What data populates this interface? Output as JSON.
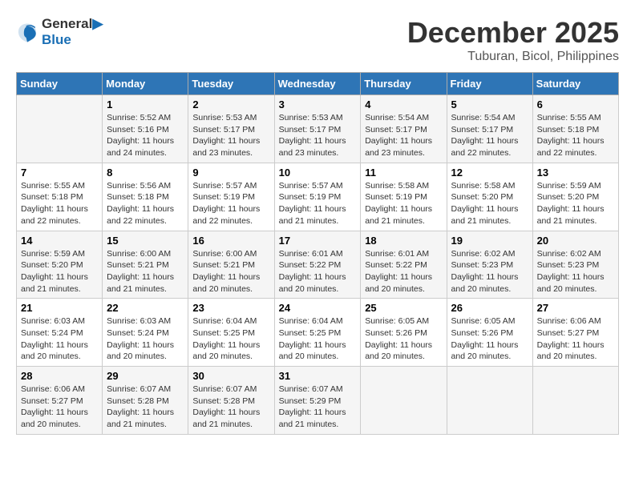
{
  "logo": {
    "line1": "General",
    "line2": "Blue"
  },
  "header": {
    "month": "December 2025",
    "location": "Tuburan, Bicol, Philippines"
  },
  "weekdays": [
    "Sunday",
    "Monday",
    "Tuesday",
    "Wednesday",
    "Thursday",
    "Friday",
    "Saturday"
  ],
  "weeks": [
    [
      {
        "day": "",
        "sunrise": "",
        "sunset": "",
        "daylight": ""
      },
      {
        "day": "1",
        "sunrise": "Sunrise: 5:52 AM",
        "sunset": "Sunset: 5:16 PM",
        "daylight": "Daylight: 11 hours and 24 minutes."
      },
      {
        "day": "2",
        "sunrise": "Sunrise: 5:53 AM",
        "sunset": "Sunset: 5:17 PM",
        "daylight": "Daylight: 11 hours and 23 minutes."
      },
      {
        "day": "3",
        "sunrise": "Sunrise: 5:53 AM",
        "sunset": "Sunset: 5:17 PM",
        "daylight": "Daylight: 11 hours and 23 minutes."
      },
      {
        "day": "4",
        "sunrise": "Sunrise: 5:54 AM",
        "sunset": "Sunset: 5:17 PM",
        "daylight": "Daylight: 11 hours and 23 minutes."
      },
      {
        "day": "5",
        "sunrise": "Sunrise: 5:54 AM",
        "sunset": "Sunset: 5:17 PM",
        "daylight": "Daylight: 11 hours and 22 minutes."
      },
      {
        "day": "6",
        "sunrise": "Sunrise: 5:55 AM",
        "sunset": "Sunset: 5:18 PM",
        "daylight": "Daylight: 11 hours and 22 minutes."
      }
    ],
    [
      {
        "day": "7",
        "sunrise": "Sunrise: 5:55 AM",
        "sunset": "Sunset: 5:18 PM",
        "daylight": "Daylight: 11 hours and 22 minutes."
      },
      {
        "day": "8",
        "sunrise": "Sunrise: 5:56 AM",
        "sunset": "Sunset: 5:18 PM",
        "daylight": "Daylight: 11 hours and 22 minutes."
      },
      {
        "day": "9",
        "sunrise": "Sunrise: 5:57 AM",
        "sunset": "Sunset: 5:19 PM",
        "daylight": "Daylight: 11 hours and 22 minutes."
      },
      {
        "day": "10",
        "sunrise": "Sunrise: 5:57 AM",
        "sunset": "Sunset: 5:19 PM",
        "daylight": "Daylight: 11 hours and 21 minutes."
      },
      {
        "day": "11",
        "sunrise": "Sunrise: 5:58 AM",
        "sunset": "Sunset: 5:19 PM",
        "daylight": "Daylight: 11 hours and 21 minutes."
      },
      {
        "day": "12",
        "sunrise": "Sunrise: 5:58 AM",
        "sunset": "Sunset: 5:20 PM",
        "daylight": "Daylight: 11 hours and 21 minutes."
      },
      {
        "day": "13",
        "sunrise": "Sunrise: 5:59 AM",
        "sunset": "Sunset: 5:20 PM",
        "daylight": "Daylight: 11 hours and 21 minutes."
      }
    ],
    [
      {
        "day": "14",
        "sunrise": "Sunrise: 5:59 AM",
        "sunset": "Sunset: 5:20 PM",
        "daylight": "Daylight: 11 hours and 21 minutes."
      },
      {
        "day": "15",
        "sunrise": "Sunrise: 6:00 AM",
        "sunset": "Sunset: 5:21 PM",
        "daylight": "Daylight: 11 hours and 21 minutes."
      },
      {
        "day": "16",
        "sunrise": "Sunrise: 6:00 AM",
        "sunset": "Sunset: 5:21 PM",
        "daylight": "Daylight: 11 hours and 20 minutes."
      },
      {
        "day": "17",
        "sunrise": "Sunrise: 6:01 AM",
        "sunset": "Sunset: 5:22 PM",
        "daylight": "Daylight: 11 hours and 20 minutes."
      },
      {
        "day": "18",
        "sunrise": "Sunrise: 6:01 AM",
        "sunset": "Sunset: 5:22 PM",
        "daylight": "Daylight: 11 hours and 20 minutes."
      },
      {
        "day": "19",
        "sunrise": "Sunrise: 6:02 AM",
        "sunset": "Sunset: 5:23 PM",
        "daylight": "Daylight: 11 hours and 20 minutes."
      },
      {
        "day": "20",
        "sunrise": "Sunrise: 6:02 AM",
        "sunset": "Sunset: 5:23 PM",
        "daylight": "Daylight: 11 hours and 20 minutes."
      }
    ],
    [
      {
        "day": "21",
        "sunrise": "Sunrise: 6:03 AM",
        "sunset": "Sunset: 5:24 PM",
        "daylight": "Daylight: 11 hours and 20 minutes."
      },
      {
        "day": "22",
        "sunrise": "Sunrise: 6:03 AM",
        "sunset": "Sunset: 5:24 PM",
        "daylight": "Daylight: 11 hours and 20 minutes."
      },
      {
        "day": "23",
        "sunrise": "Sunrise: 6:04 AM",
        "sunset": "Sunset: 5:25 PM",
        "daylight": "Daylight: 11 hours and 20 minutes."
      },
      {
        "day": "24",
        "sunrise": "Sunrise: 6:04 AM",
        "sunset": "Sunset: 5:25 PM",
        "daylight": "Daylight: 11 hours and 20 minutes."
      },
      {
        "day": "25",
        "sunrise": "Sunrise: 6:05 AM",
        "sunset": "Sunset: 5:26 PM",
        "daylight": "Daylight: 11 hours and 20 minutes."
      },
      {
        "day": "26",
        "sunrise": "Sunrise: 6:05 AM",
        "sunset": "Sunset: 5:26 PM",
        "daylight": "Daylight: 11 hours and 20 minutes."
      },
      {
        "day": "27",
        "sunrise": "Sunrise: 6:06 AM",
        "sunset": "Sunset: 5:27 PM",
        "daylight": "Daylight: 11 hours and 20 minutes."
      }
    ],
    [
      {
        "day": "28",
        "sunrise": "Sunrise: 6:06 AM",
        "sunset": "Sunset: 5:27 PM",
        "daylight": "Daylight: 11 hours and 20 minutes."
      },
      {
        "day": "29",
        "sunrise": "Sunrise: 6:07 AM",
        "sunset": "Sunset: 5:28 PM",
        "daylight": "Daylight: 11 hours and 21 minutes."
      },
      {
        "day": "30",
        "sunrise": "Sunrise: 6:07 AM",
        "sunset": "Sunset: 5:28 PM",
        "daylight": "Daylight: 11 hours and 21 minutes."
      },
      {
        "day": "31",
        "sunrise": "Sunrise: 6:07 AM",
        "sunset": "Sunset: 5:29 PM",
        "daylight": "Daylight: 11 hours and 21 minutes."
      },
      {
        "day": "",
        "sunrise": "",
        "sunset": "",
        "daylight": ""
      },
      {
        "day": "",
        "sunrise": "",
        "sunset": "",
        "daylight": ""
      },
      {
        "day": "",
        "sunrise": "",
        "sunset": "",
        "daylight": ""
      }
    ]
  ]
}
